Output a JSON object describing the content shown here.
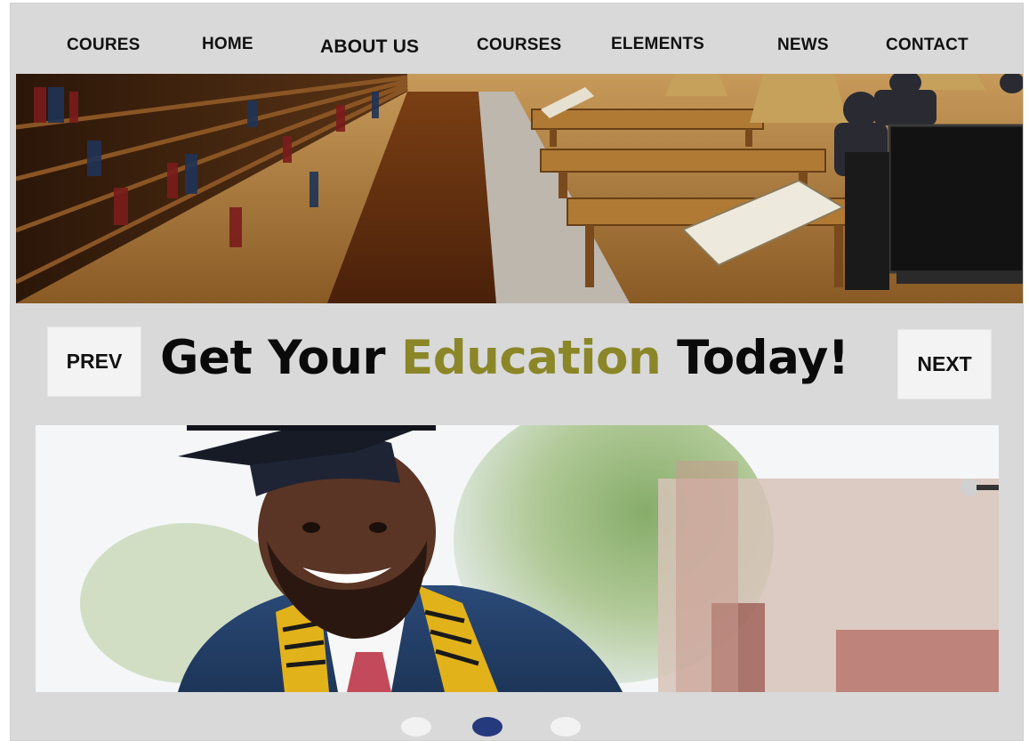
{
  "nav": {
    "items": [
      {
        "label": "COURES"
      },
      {
        "label": "HOME"
      },
      {
        "label": "ABOUT US"
      },
      {
        "label": "COURSES"
      },
      {
        "label": "ELEMENTS"
      },
      {
        "label": "NEWS"
      },
      {
        "label": "CONTACT"
      }
    ]
  },
  "slider": {
    "prev_label": "PREV",
    "next_label": "NEXT",
    "headline_part1": "Get Your ",
    "headline_accent": "Education",
    "headline_part2": " Today!",
    "active_dot": 2,
    "dot_count": 3
  },
  "colors": {
    "frame_bg": "#d9d9d9",
    "accent": "#8b8628",
    "dot_active": "#243a7d",
    "dot_inactive": "#f2f2f2",
    "button_bg": "#f3f3f3"
  },
  "images": {
    "top": "library-reading-room-photo",
    "bottom": "smiling-graduate-photo"
  }
}
